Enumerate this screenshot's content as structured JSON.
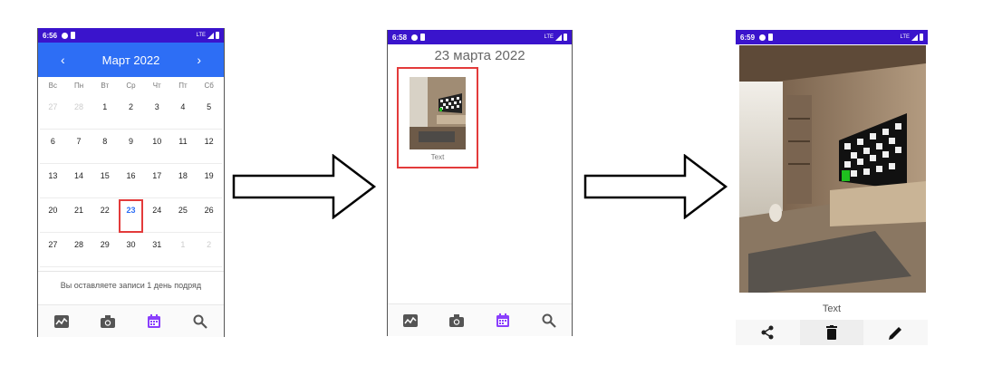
{
  "screen1": {
    "status": {
      "time": "6:56",
      "network": "LTE"
    },
    "calendar": {
      "month_label": "Март  2022",
      "prev_icon": "chevron-left-icon",
      "next_icon": "chevron-right-icon",
      "weekdays": [
        "Вс",
        "Пн",
        "Вт",
        "Ср",
        "Чт",
        "Пт",
        "Сб"
      ],
      "weeks": [
        [
          {
            "d": "27",
            "muted": true
          },
          {
            "d": "28",
            "muted": true
          },
          {
            "d": "1"
          },
          {
            "d": "2"
          },
          {
            "d": "3"
          },
          {
            "d": "4"
          },
          {
            "d": "5"
          }
        ],
        [
          {
            "d": "6"
          },
          {
            "d": "7"
          },
          {
            "d": "8"
          },
          {
            "d": "9"
          },
          {
            "d": "10"
          },
          {
            "d": "11"
          },
          {
            "d": "12"
          }
        ],
        [
          {
            "d": "13"
          },
          {
            "d": "14"
          },
          {
            "d": "15"
          },
          {
            "d": "16"
          },
          {
            "d": "17"
          },
          {
            "d": "18"
          },
          {
            "d": "19"
          }
        ],
        [
          {
            "d": "20"
          },
          {
            "d": "21"
          },
          {
            "d": "22"
          },
          {
            "d": "23",
            "today": true
          },
          {
            "d": "24"
          },
          {
            "d": "25"
          },
          {
            "d": "26"
          }
        ],
        [
          {
            "d": "27"
          },
          {
            "d": "28"
          },
          {
            "d": "29"
          },
          {
            "d": "30"
          },
          {
            "d": "31"
          },
          {
            "d": "1",
            "muted": true
          },
          {
            "d": "2",
            "muted": true
          }
        ]
      ],
      "streak_text": "Вы оставляете записи 1 день подряд"
    }
  },
  "screen2": {
    "status": {
      "time": "6:58",
      "network": "LTE"
    },
    "date_title": "23 марта 2022",
    "entry_label": "Text"
  },
  "screen3": {
    "status": {
      "time": "6:59",
      "network": "LTE"
    },
    "caption": "Text"
  },
  "bottom_nav": [
    "chart-icon",
    "camera-icon",
    "calendar-icon",
    "search-icon"
  ],
  "detail_actions": [
    "share-icon",
    "delete-icon",
    "edit-icon"
  ],
  "colors": {
    "statusbar": "#3a14cc",
    "header": "#2d6ef5",
    "highlight": "#e33b3b",
    "active_nav": "#8a3ffc"
  }
}
